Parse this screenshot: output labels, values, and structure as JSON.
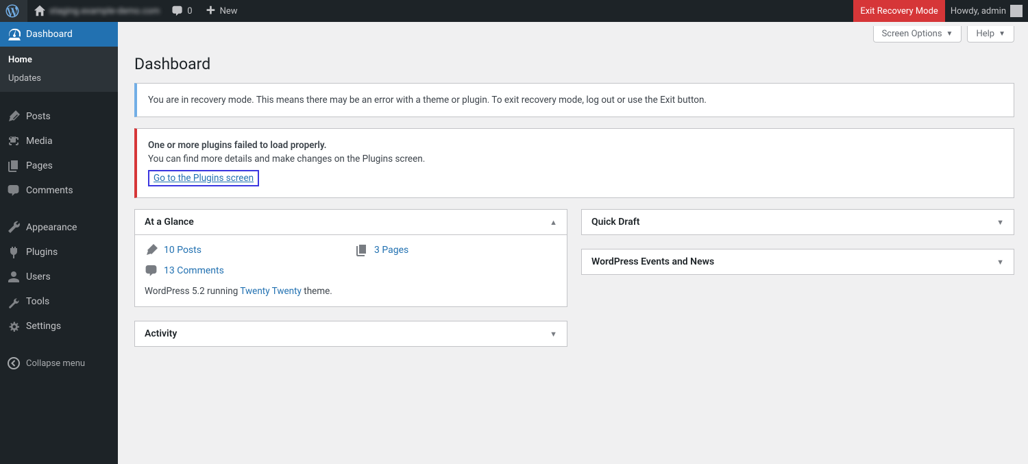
{
  "adminbar": {
    "site_name": "staging.example-demo.com",
    "comments_count": "0",
    "new_label": "New",
    "exit_recovery_label": "Exit Recovery Mode",
    "howdy": "Howdy, admin"
  },
  "sidebar": {
    "items": [
      {
        "label": "Dashboard"
      },
      {
        "label": "Posts"
      },
      {
        "label": "Media"
      },
      {
        "label": "Pages"
      },
      {
        "label": "Comments"
      },
      {
        "label": "Appearance"
      },
      {
        "label": "Plugins"
      },
      {
        "label": "Users"
      },
      {
        "label": "Tools"
      },
      {
        "label": "Settings"
      }
    ],
    "submenu": {
      "home": "Home",
      "updates": "Updates"
    },
    "collapse": "Collapse menu"
  },
  "tabs": {
    "screen_options": "Screen Options",
    "help": "Help"
  },
  "page": {
    "title": "Dashboard"
  },
  "notice_info": {
    "text": "You are in recovery mode. This means there may be an error with a theme or plugin. To exit recovery mode, log out or use the Exit button."
  },
  "notice_error": {
    "line1": "One or more plugins failed to load properly.",
    "line2": "You can find more details and make changes on the Plugins screen.",
    "link": "Go to the Plugins screen"
  },
  "boxes": {
    "glance": {
      "title": "At a Glance",
      "posts": "10 Posts",
      "pages": "3 Pages",
      "comments": "13 Comments",
      "version_pre": "WordPress 5.2 running ",
      "theme": "Twenty Twenty",
      "version_post": " theme."
    },
    "activity": {
      "title": "Activity"
    },
    "quickdraft": {
      "title": "Quick Draft"
    },
    "news": {
      "title": "WordPress Events and News"
    }
  }
}
